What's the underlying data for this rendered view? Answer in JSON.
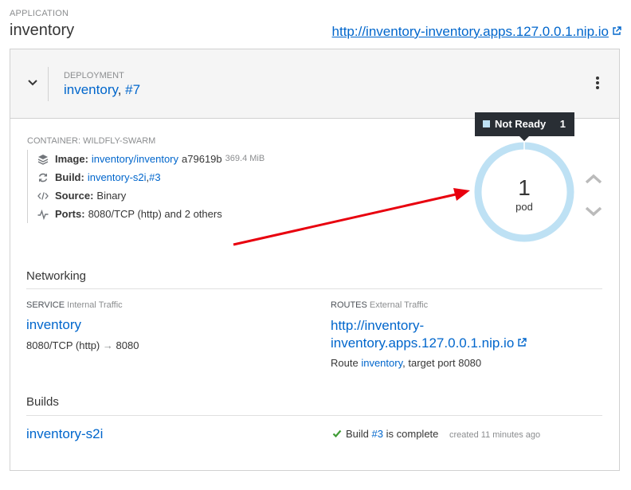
{
  "application": {
    "label": "APPLICATION",
    "name": "inventory",
    "url": "http://inventory-inventory.apps.127.0.0.1.nip.io"
  },
  "deployment": {
    "label": "DEPLOYMENT",
    "name": "inventory",
    "separator": ", ",
    "revision": "#7"
  },
  "container": {
    "label": "CONTAINER: WILDFLY-SWARM",
    "image": {
      "key": "Image:",
      "name": "inventory/inventory",
      "hash": "a79619b",
      "size": "369.4 MiB",
      "icon": "layers-icon"
    },
    "build": {
      "key": "Build:",
      "name": "inventory-s2i",
      "separator": ", ",
      "number": "#3",
      "icon": "refresh-icon"
    },
    "source": {
      "key": "Source:",
      "value": "Binary",
      "icon": "code-icon"
    },
    "ports": {
      "key": "Ports:",
      "value": "8080/TCP (http) and 2 others",
      "icon": "pulse-icon"
    }
  },
  "pods": {
    "tooltip_status": "Not Ready",
    "tooltip_count": "1",
    "count": "1",
    "label": "pod",
    "ring_color": "#bee1f4"
  },
  "networking": {
    "title": "Networking",
    "service": {
      "label": "SERVICE",
      "sublabel": "Internal Traffic",
      "name": "inventory",
      "port_from": "8080/TCP (http)",
      "arrow": "→",
      "port_to": "8080"
    },
    "routes": {
      "label": "ROUTES",
      "sublabel": "External Traffic",
      "url_line1": "http://inventory-",
      "url_line2": "inventory.apps.127.0.0.1.nip.io",
      "route_prefix": "Route",
      "route_name": "inventory",
      "route_suffix": ", target port 8080"
    }
  },
  "builds": {
    "title": "Builds",
    "name": "inventory-s2i",
    "status_prefix": "Build",
    "number": "#3",
    "status_suffix": "is complete",
    "created": "created 11 minutes ago",
    "status_color": "#3f9c35"
  },
  "colors": {
    "link": "#0066cc",
    "annotation_arrow": "#e8000e"
  }
}
